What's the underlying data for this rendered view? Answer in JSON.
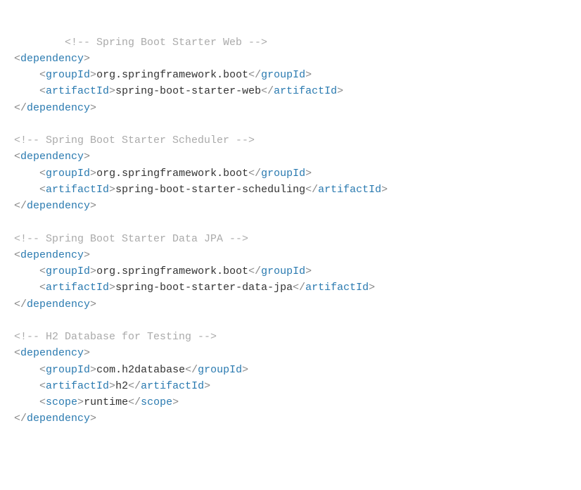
{
  "colors": {
    "tag": "#2a7ab0",
    "comment": "#aaa",
    "text": "#333",
    "angle": "#888"
  },
  "indent": {
    "base": "    ",
    "double": "        "
  },
  "deps": [
    {
      "comment": "<!-- Spring Boot Starter Web -->",
      "comment_indent": "        ",
      "groupId": "org.springframework.boot",
      "artifactId": "spring-boot-starter-web"
    },
    {
      "comment": "<!-- Spring Boot Starter Scheduler -->",
      "comment_indent": "",
      "groupId": "org.springframework.boot",
      "artifactId": "spring-boot-starter-scheduling"
    },
    {
      "comment": "<!-- Spring Boot Starter Data JPA -->",
      "comment_indent": "",
      "groupId": "org.springframework.boot",
      "artifactId": "spring-boot-starter-data-jpa"
    },
    {
      "comment": "<!-- H2 Database for Testing -->",
      "comment_indent": "",
      "groupId": "com.h2database",
      "artifactId": "h2",
      "scope": "runtime"
    }
  ]
}
